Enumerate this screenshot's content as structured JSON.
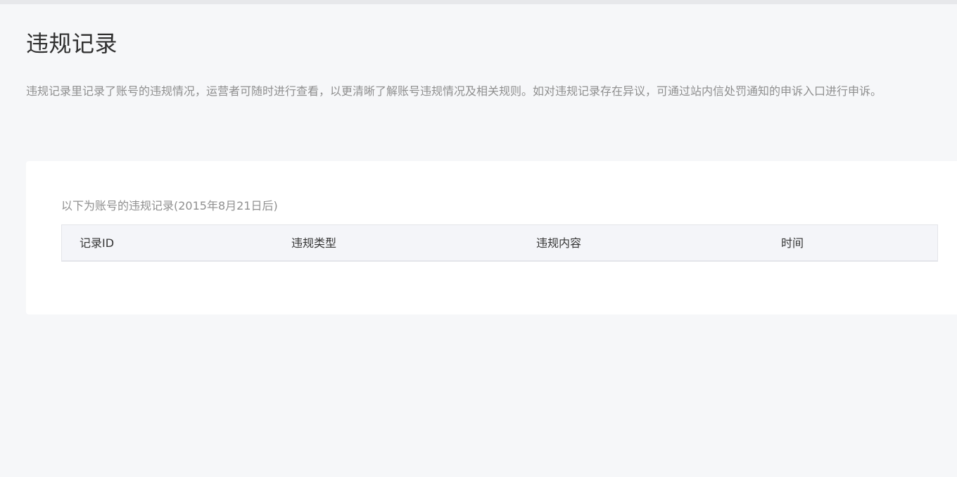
{
  "page": {
    "title": "违规记录",
    "description": "违规记录里记录了账号的违规情况，运营者可随时进行查看，以更清晰了解账号违规情况及相关规则。如对违规记录存在异议，可通过站内信处罚通知的申诉入口进行申诉。"
  },
  "records": {
    "caption": "以下为账号的违规记录(2015年8月21日后)",
    "columns": [
      "记录ID",
      "违规类型",
      "违规内容",
      "时间"
    ],
    "rows": []
  },
  "colors": {
    "page_background": "#f6f7f9",
    "panel_background": "#ffffff",
    "table_header_background": "#f4f5f9",
    "primary_text": "#353535",
    "secondary_text": "#8f8f8f"
  }
}
